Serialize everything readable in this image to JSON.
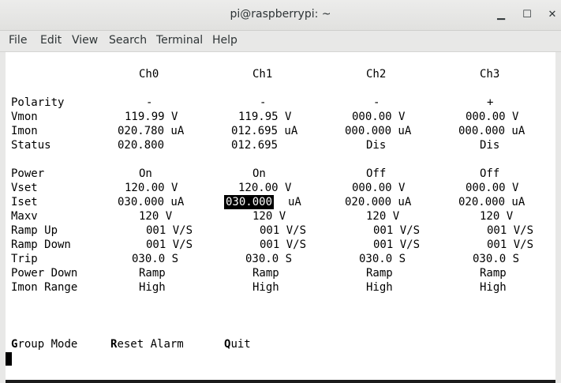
{
  "window": {
    "title": "pi@raspberrypi: ~",
    "minimize_glyph": "▁",
    "maximize_glyph": "☐",
    "close_glyph": "✕"
  },
  "menu": [
    "File",
    "Edit",
    "View",
    "Search",
    "Terminal",
    "Help"
  ],
  "channels": [
    "Ch0",
    "Ch1",
    "Ch2",
    "Ch3"
  ],
  "section1": [
    {
      "label": "Polarity",
      "values": [
        "-",
        "-",
        "-",
        "+"
      ]
    },
    {
      "label": "Vmon",
      "values": [
        "119.99 V",
        "119.95 V",
        "000.00 V",
        "000.00 V"
      ]
    },
    {
      "label": "Imon",
      "values": [
        "020.780 uA",
        "012.695 uA",
        "000.000 uA",
        "000.000 uA"
      ]
    },
    {
      "label": "Status",
      "values": [
        "020.800",
        "012.695",
        "Dis",
        "Dis"
      ]
    }
  ],
  "section2": [
    {
      "label": "Power",
      "values": [
        "On",
        "On",
        "Off",
        "Off"
      ]
    },
    {
      "label": "Vset",
      "values": [
        "120.00 V",
        "120.00 V",
        "000.00 V",
        "000.00 V"
      ]
    },
    {
      "label": "Iset",
      "values": [
        "030.000 uA",
        "030.000",
        "020.000 uA",
        "020.000 uA"
      ],
      "extra": "uA"
    },
    {
      "label": "Maxv",
      "values": [
        "120 V",
        "120 V",
        "120 V",
        "120 V"
      ]
    },
    {
      "label": "Ramp Up",
      "values": [
        "001 V/S",
        "001 V/S",
        "001 V/S",
        "001 V/S"
      ]
    },
    {
      "label": "Ramp Down",
      "values": [
        "001 V/S",
        "001 V/S",
        "001 V/S",
        "001 V/S"
      ]
    },
    {
      "label": "Trip",
      "values": [
        "030.0 S",
        "030.0 S",
        "030.0 S",
        "030.0 S"
      ]
    },
    {
      "label": "Power Down",
      "values": [
        "Ramp",
        "Ramp",
        "Ramp",
        "Ramp"
      ]
    },
    {
      "label": "Imon Range",
      "values": [
        "High",
        "High",
        "High",
        "High"
      ]
    }
  ],
  "commands": [
    {
      "key": "G",
      "rest": "roup Mode"
    },
    {
      "key": "R",
      "rest": "eset Alarm"
    },
    {
      "key": "Q",
      "rest": "uit"
    }
  ]
}
